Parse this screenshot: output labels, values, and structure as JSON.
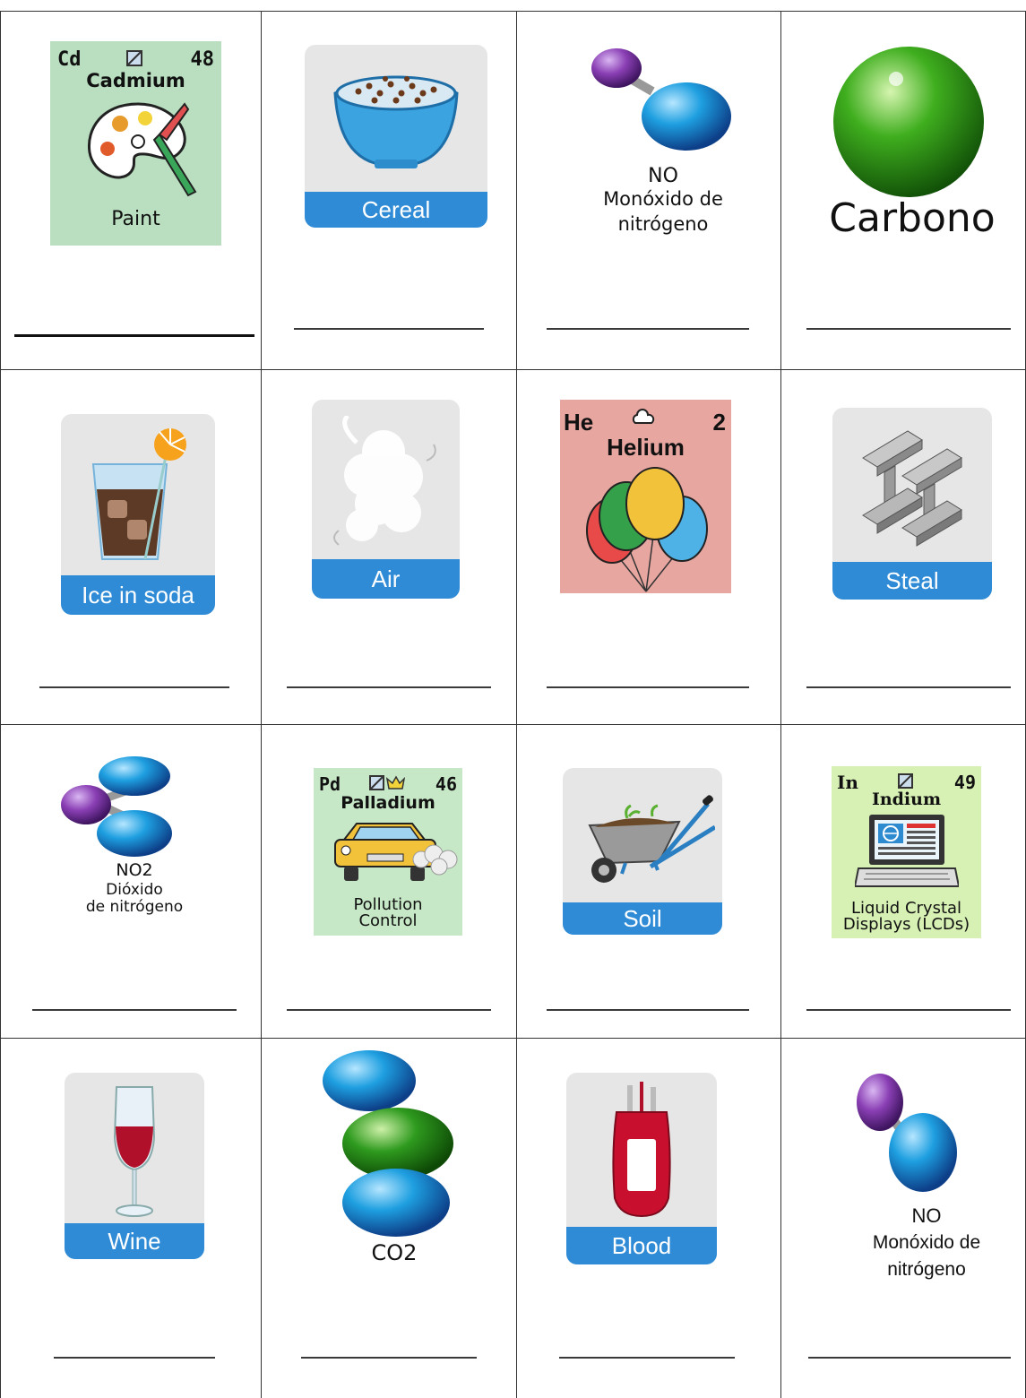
{
  "grid": {
    "row1": {
      "cadmium": {
        "symbol": "Cd",
        "number": "48",
        "name": "Cadmium",
        "use": "Paint"
      },
      "cereal": {
        "label": "Cereal"
      },
      "no": {
        "formula": "NO",
        "line1": "Monóxido de",
        "line2": "nitrógeno"
      },
      "carbono": {
        "label": "Carbono"
      }
    },
    "row2": {
      "ice": {
        "label": "Ice in soda"
      },
      "air": {
        "label": "Air"
      },
      "helium": {
        "symbol": "He",
        "number": "2",
        "name": "Helium"
      },
      "steal": {
        "label": "Steal"
      }
    },
    "row3": {
      "no2": {
        "formula": "NO2",
        "line1": "Dióxido",
        "line2": "de nitrógeno"
      },
      "palladium": {
        "symbol": "Pd",
        "number": "46",
        "name": "Palladium",
        "use1": "Pollution",
        "use2": "Control"
      },
      "soil": {
        "label": "Soil"
      },
      "indium": {
        "symbol": "In",
        "number": "49",
        "name": "Indium",
        "use1": "Liquid Crystal",
        "use2": "Displays (LCDs)"
      }
    },
    "row4": {
      "wine": {
        "label": "Wine"
      },
      "co2": {
        "formula": "CO2"
      },
      "blood": {
        "label": "Blood"
      },
      "no": {
        "formula": "NO",
        "line1": "Monóxido de",
        "line2": "nitrógeno"
      }
    }
  },
  "colors": {
    "cadmium_bg": "#b9dfc0",
    "helium_bg": "#e8a6a0",
    "palladium_bg": "#c6e8c6",
    "indium_bg": "#d7f0b4",
    "card_bg": "#e6e6e6",
    "label_bar": "#2f8bd6",
    "blue_atom": "#1e78c8",
    "purple_atom": "#8a3fb4",
    "green_atom": "#2e9a1e"
  }
}
